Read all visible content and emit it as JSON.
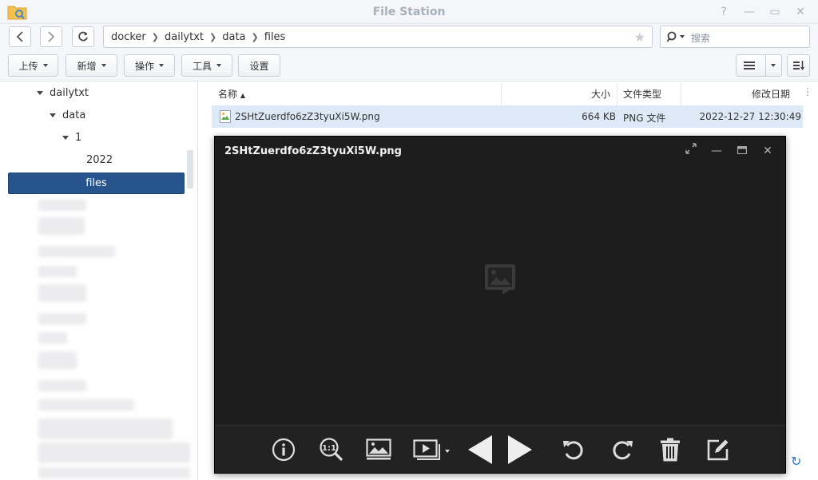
{
  "window": {
    "title": "File Station"
  },
  "path": {
    "segments": [
      "docker",
      "dailytxt",
      "data",
      "files"
    ]
  },
  "search": {
    "placeholder": "搜索"
  },
  "toolbar": {
    "upload": "上传",
    "create": "新增",
    "action": "操作",
    "tools": "工具",
    "settings": "设置"
  },
  "tree": {
    "dailytxt": "dailytxt",
    "data": "data",
    "one": "1",
    "year": "2022",
    "selected": "files"
  },
  "columns": {
    "name": "名称",
    "size": "大小",
    "type": "文件类型",
    "modified": "修改日期"
  },
  "file": {
    "name": "2SHtZuerdfo6zZ3tyuXi5W.png",
    "size": "664 KB",
    "type": "PNG 文件",
    "modified": "2022-12-27 12:30:49"
  },
  "viewer": {
    "title": "2SHtZuerdfo6zZ3tyuXi5W.png"
  },
  "colors": {
    "accent": "#27548c",
    "selectedRow": "#dde9f6",
    "viewerBg": "#1d1d1d"
  }
}
